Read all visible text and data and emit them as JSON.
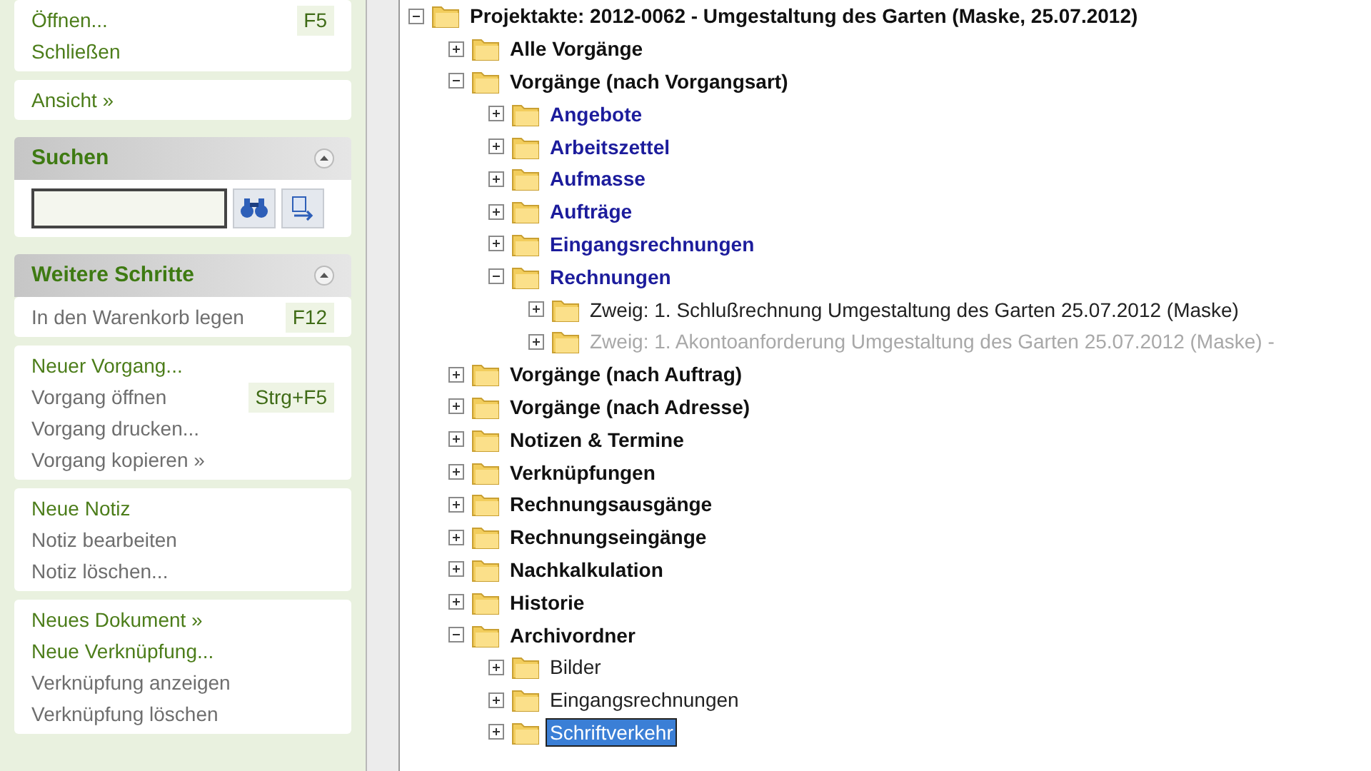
{
  "sidebar": {
    "panels": [
      {
        "kind": "menu",
        "items": [
          {
            "label": "Öffnen...",
            "enabled": true,
            "shortcut": "F5"
          },
          {
            "label": "Schließen",
            "enabled": true
          }
        ]
      },
      {
        "kind": "menu",
        "items": [
          {
            "label": "Ansicht »",
            "enabled": true
          }
        ]
      },
      {
        "kind": "header",
        "title": "Suchen",
        "expanded": true
      },
      {
        "kind": "search"
      },
      {
        "kind": "header",
        "title": "Weitere Schritte",
        "expanded": true
      },
      {
        "kind": "menu",
        "items": [
          {
            "label": "In den Warenkorb legen",
            "enabled": false,
            "shortcut": "F12"
          }
        ]
      },
      {
        "kind": "menu",
        "items": [
          {
            "label": "Neuer Vorgang...",
            "enabled": true
          },
          {
            "label": "Vorgang öffnen",
            "enabled": false,
            "shortcut": "Strg+F5"
          },
          {
            "label": "Vorgang drucken...",
            "enabled": false
          },
          {
            "label": "Vorgang kopieren »",
            "enabled": false
          }
        ]
      },
      {
        "kind": "menu",
        "items": [
          {
            "label": "Neue Notiz",
            "enabled": true
          },
          {
            "label": "Notiz bearbeiten",
            "enabled": false
          },
          {
            "label": "Notiz löschen...",
            "enabled": false
          }
        ]
      },
      {
        "kind": "menu",
        "items": [
          {
            "label": "Neues Dokument »",
            "enabled": true
          },
          {
            "label": "Neue Verknüpfung...",
            "enabled": true
          },
          {
            "label": "Verknüpfung anzeigen",
            "enabled": false
          },
          {
            "label": "Verknüpfung löschen",
            "enabled": false
          }
        ]
      }
    ]
  },
  "tree": {
    "label": "Projektakte: 2012-0062 - Umgestaltung des Garten (Maske, 25.07.2012)",
    "kind": "group",
    "expanded": true,
    "selected": false,
    "children": [
      {
        "label": "Alle Vorgänge",
        "kind": "group",
        "expanded": false,
        "selected": false
      },
      {
        "label": "Vorgänge (nach Vorgangsart)",
        "kind": "group",
        "expanded": true,
        "selected": false,
        "children": [
          {
            "label": "Angebote",
            "kind": "type",
            "expanded": false,
            "selected": false
          },
          {
            "label": "Arbeitszettel",
            "kind": "type",
            "expanded": false,
            "selected": false
          },
          {
            "label": "Aufmasse",
            "kind": "type",
            "expanded": false,
            "selected": false
          },
          {
            "label": "Aufträge",
            "kind": "type",
            "expanded": false,
            "selected": false
          },
          {
            "label": "Eingangsrechnungen",
            "kind": "type",
            "expanded": false,
            "selected": false
          },
          {
            "label": "Rechnungen",
            "kind": "type",
            "expanded": true,
            "selected": false,
            "children": [
              {
                "label": "Zweig: 1. Schlußrechnung Umgestaltung des Garten 25.07.2012 (Maske)",
                "kind": "entry",
                "expanded": false,
                "selected": false,
                "disabled": false
              },
              {
                "label": "Zweig: 1. Akontoanforderung Umgestaltung des Garten 25.07.2012 (Maske) -",
                "kind": "entry",
                "expanded": false,
                "selected": false,
                "disabled": true
              }
            ]
          }
        ]
      },
      {
        "label": "Vorgänge (nach Auftrag)",
        "kind": "group",
        "expanded": false,
        "selected": false
      },
      {
        "label": "Vorgänge (nach Adresse)",
        "kind": "group",
        "expanded": false,
        "selected": false
      },
      {
        "label": "Notizen & Termine",
        "kind": "group",
        "expanded": false,
        "selected": false
      },
      {
        "label": "Verknüpfungen",
        "kind": "group",
        "expanded": false,
        "selected": false
      },
      {
        "label": "Rechnungsausgänge",
        "kind": "group",
        "expanded": false,
        "selected": false
      },
      {
        "label": "Rechnungseingänge",
        "kind": "group",
        "expanded": false,
        "selected": false
      },
      {
        "label": "Nachkalkulation",
        "kind": "group",
        "expanded": false,
        "selected": false
      },
      {
        "label": "Historie",
        "kind": "group",
        "expanded": false,
        "selected": false
      },
      {
        "label": "Archivordner",
        "kind": "group",
        "expanded": true,
        "selected": false,
        "children": [
          {
            "label": "Bilder",
            "kind": "entry",
            "expanded": false,
            "selected": false,
            "disabled": false
          },
          {
            "label": "Eingangsrechnungen",
            "kind": "entry",
            "expanded": false,
            "selected": false,
            "disabled": false
          },
          {
            "label": "Schriftverkehr",
            "kind": "entry",
            "expanded": false,
            "selected": true,
            "disabled": false
          }
        ]
      }
    ]
  }
}
